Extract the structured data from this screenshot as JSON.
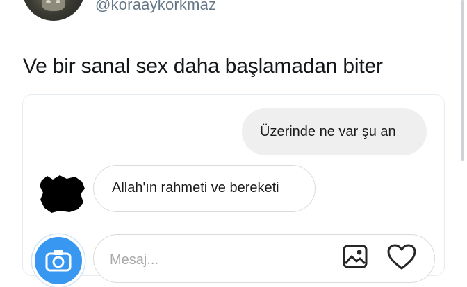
{
  "tweet": {
    "handle": "@koraaykorkmaz",
    "text": "Ve bir sanal sex daha başlamadan biter"
  },
  "chat": {
    "messages": [
      {
        "direction": "sent",
        "text": "Üzerinde ne var şu an"
      },
      {
        "direction": "received",
        "text": "Allah'ın rahmeti ve bereketi"
      }
    ],
    "input_placeholder": "Mesaj..."
  },
  "icons": {
    "camera": "camera-icon",
    "gallery": "gallery-icon",
    "heart": "heart-icon"
  },
  "colors": {
    "accent_blue": "#3897f0",
    "sent_bubble": "#efefef",
    "handle_gray": "#657786",
    "border_gray": "#dbdbdb"
  }
}
